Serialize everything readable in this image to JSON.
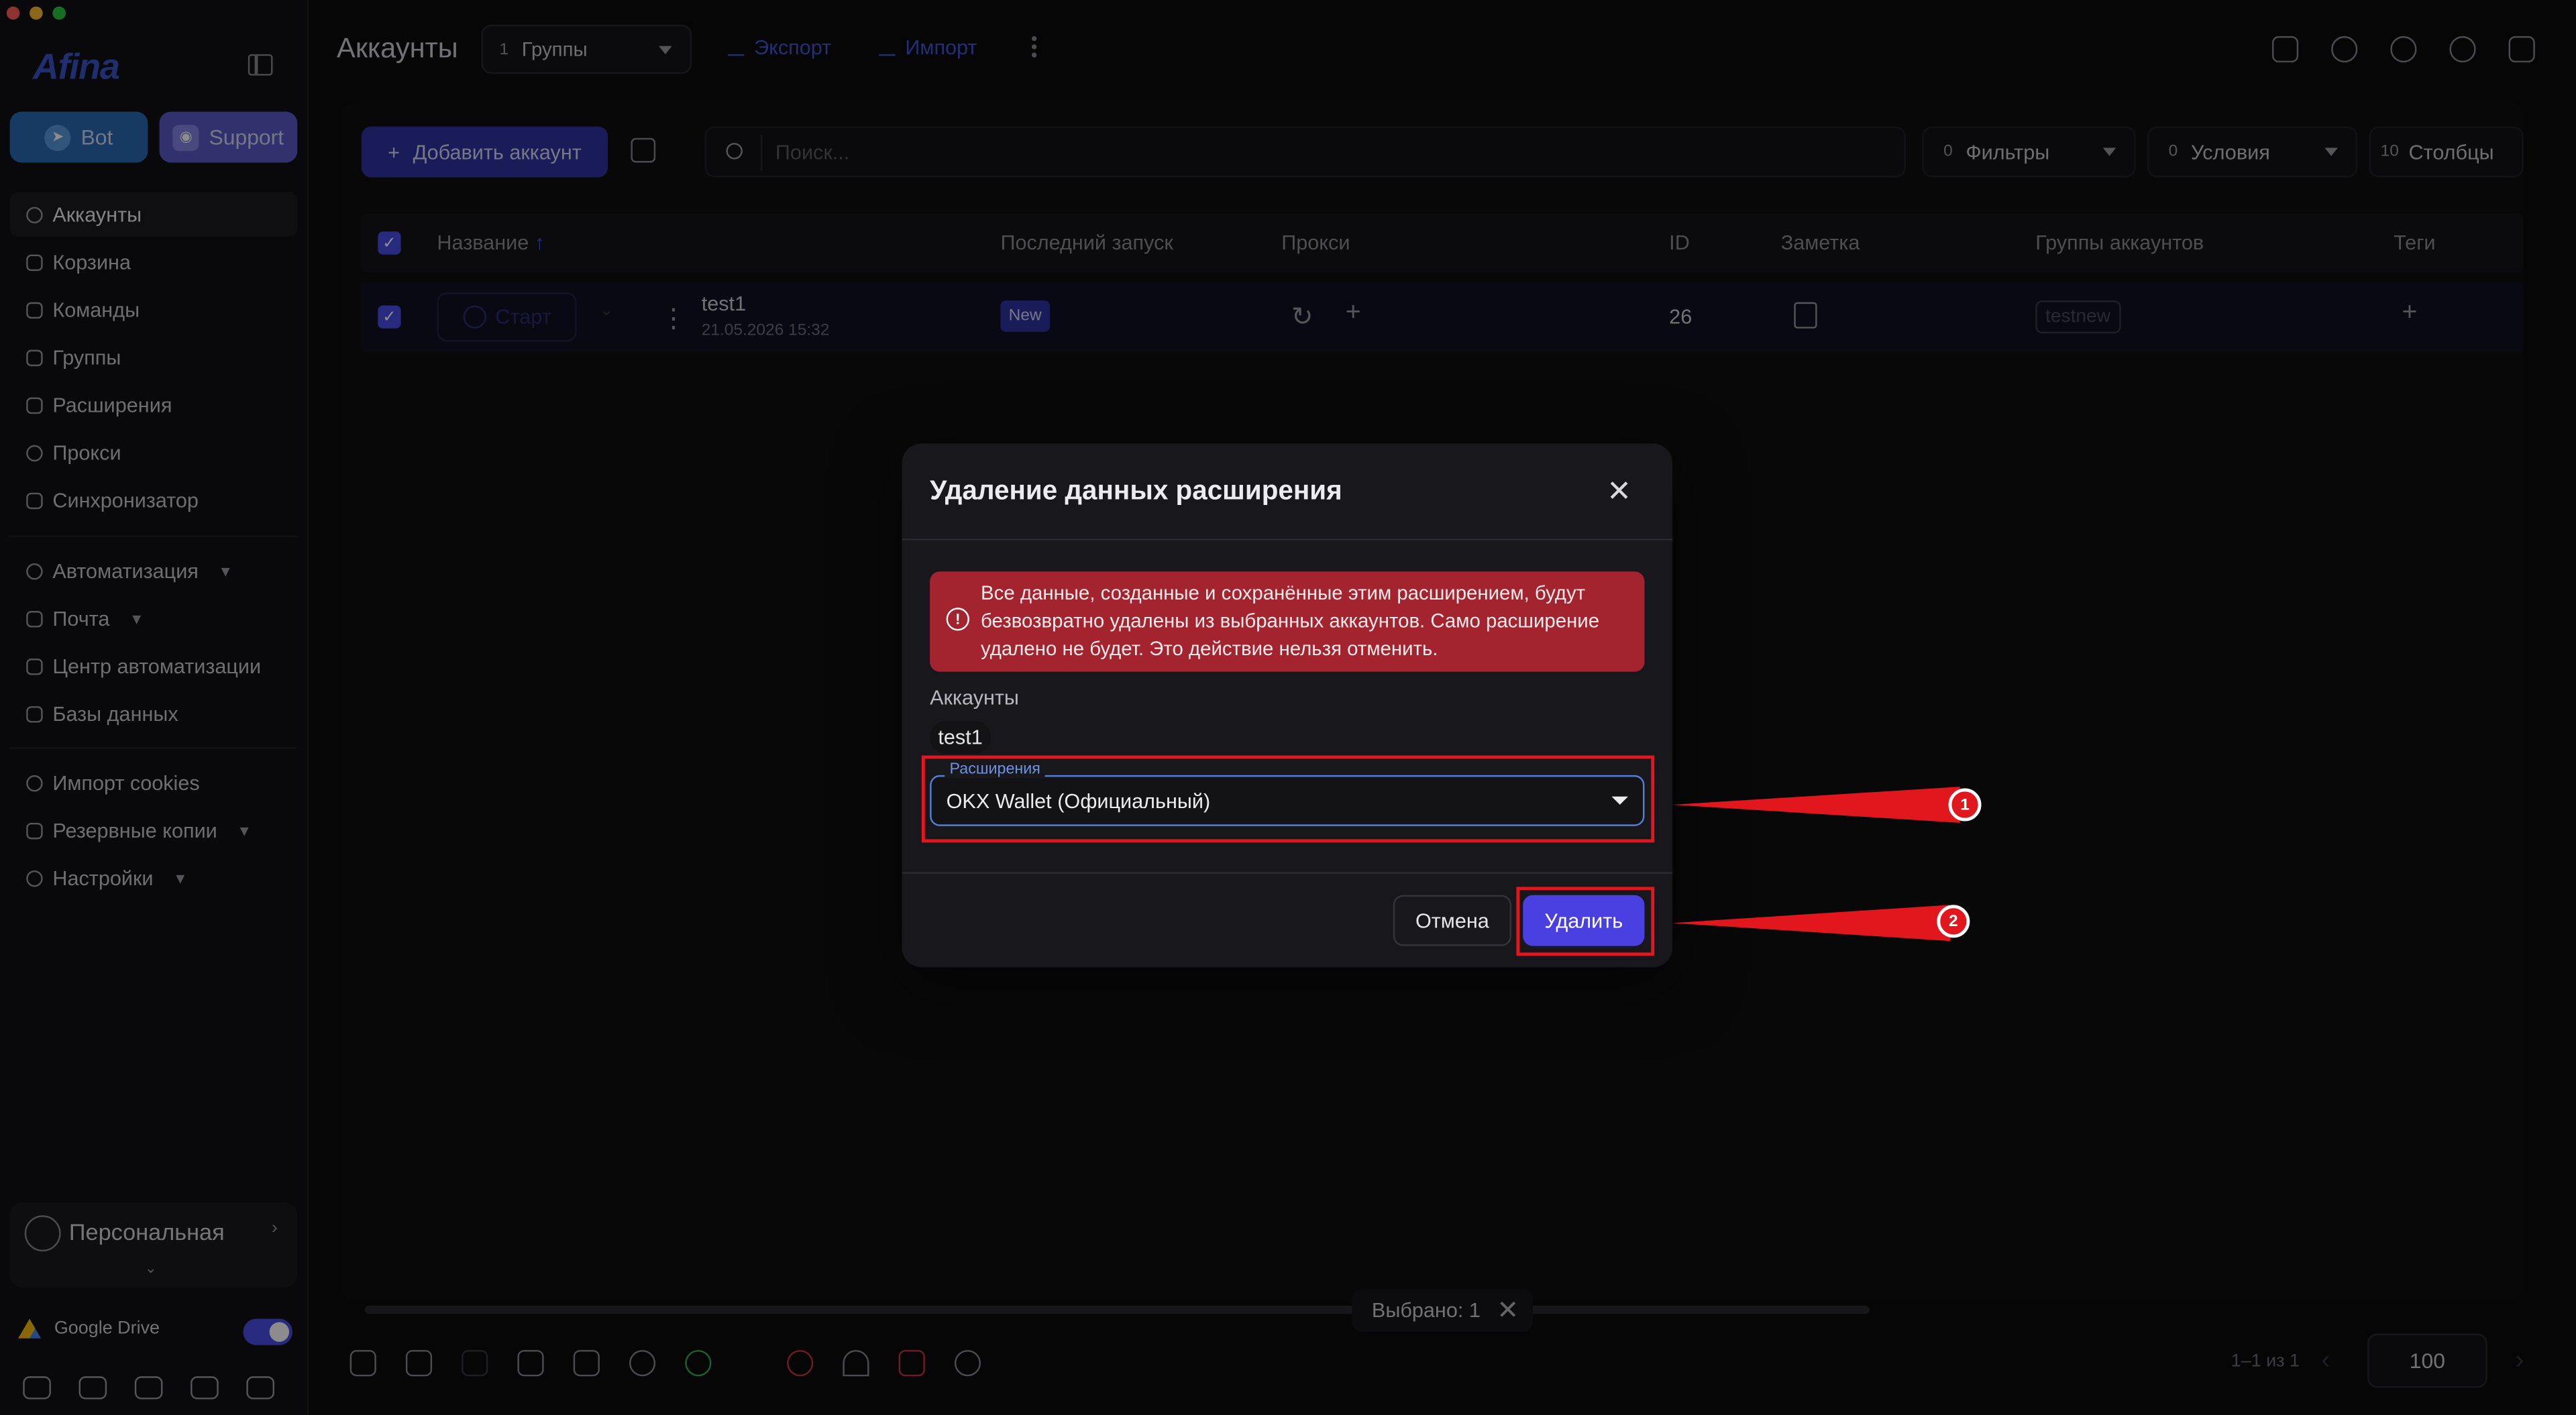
{
  "window": {
    "controls": [
      "close",
      "minimize",
      "maximize"
    ]
  },
  "sidebar": {
    "logo": "Afina",
    "bot_label": "Bot",
    "support_label": "Support",
    "items": [
      {
        "label": "Аккаунты",
        "icon": "user-circle-icon"
      },
      {
        "label": "Корзина",
        "icon": "trash-icon"
      },
      {
        "label": "Команды",
        "icon": "team-icon"
      },
      {
        "label": "Группы",
        "icon": "group-icon"
      },
      {
        "label": "Расширения",
        "icon": "puzzle-icon"
      },
      {
        "label": "Прокси",
        "icon": "cloud-icon"
      },
      {
        "label": "Синхронизатор",
        "icon": "sync-icon"
      },
      {
        "label": "Автоматизация",
        "icon": "automation-icon"
      },
      {
        "label": "Почта",
        "icon": "mail-icon"
      },
      {
        "label": "Центр автоматизации",
        "icon": "monitor-icon"
      },
      {
        "label": "Базы данных",
        "icon": "database-icon"
      },
      {
        "label": "Импорт cookies",
        "icon": "cookie-icon"
      },
      {
        "label": "Резервные копии",
        "icon": "backup-icon"
      },
      {
        "label": "Настройки",
        "icon": "gear-icon"
      }
    ],
    "workspace": "Персональная",
    "google_drive": "Google Drive"
  },
  "header": {
    "title": "Аккаунты",
    "groups_count": "1",
    "groups_label": "Группы",
    "export_label": "Экспорт",
    "import_label": "Импорт"
  },
  "toolbar": {
    "add_account": "Добавить аккаунт",
    "search_placeholder": "Поиск...",
    "filters_count": "0",
    "filters_label": "Фильтры",
    "conditions_count": "0",
    "conditions_label": "Условия",
    "columns_count": "10",
    "columns_label": "Столбцы"
  },
  "table": {
    "columns": [
      "Название",
      "Последний запуск",
      "Прокси",
      "ID",
      "Заметка",
      "Группы аккаунтов",
      "Теги"
    ],
    "sort_indicator": "↑",
    "rows": [
      {
        "start": "Старт",
        "name": "test1",
        "date": "21.05.2026 15:32",
        "last_launch": "New",
        "id": "26",
        "group": "testnew"
      }
    ]
  },
  "footer": {
    "selected": "Выбрано: 1",
    "pagination": "1–1 из 1",
    "page_size": "100"
  },
  "modal": {
    "title": "Удаление данных расширения",
    "warning": "Все данные, созданные и сохранённые этим расширением, будут безвозвратно удалены из выбранных аккаунтов. Само расширение удалено не будет. Это действие нельзя отменить.",
    "accounts_label": "Аккаунты",
    "account_chip": "test1",
    "extension_label": "Расширения",
    "extension_value": "OKX Wallet (Официальный)",
    "cancel": "Отмена",
    "delete": "Удалить"
  },
  "annotations": {
    "marker_1": "1",
    "marker_2": "2",
    "color": "#e2161d"
  },
  "colors": {
    "accent": "#4a3fe0",
    "alert": "#a3232e",
    "focus": "#4f7fd9",
    "bot": "#2a6bb3",
    "support": "#5a5cc6"
  }
}
